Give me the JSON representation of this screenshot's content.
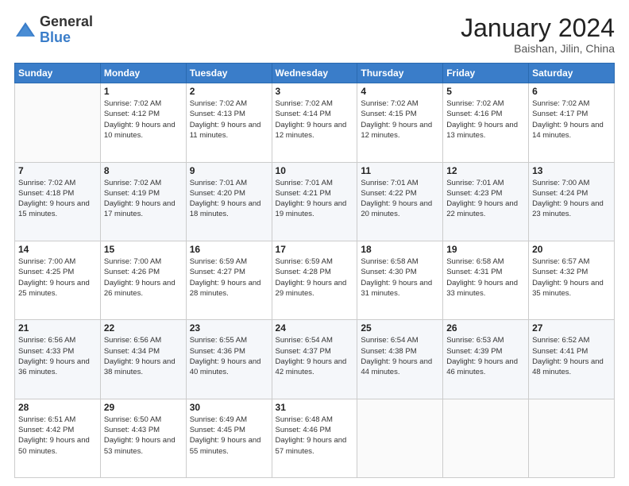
{
  "header": {
    "logo_general": "General",
    "logo_blue": "Blue",
    "month_title": "January 2024",
    "location": "Baishan, Jilin, China"
  },
  "weekdays": [
    "Sunday",
    "Monday",
    "Tuesday",
    "Wednesday",
    "Thursday",
    "Friday",
    "Saturday"
  ],
  "weeks": [
    [
      {
        "day": "",
        "sunrise": "",
        "sunset": "",
        "daylight": ""
      },
      {
        "day": "1",
        "sunrise": "Sunrise: 7:02 AM",
        "sunset": "Sunset: 4:12 PM",
        "daylight": "Daylight: 9 hours and 10 minutes."
      },
      {
        "day": "2",
        "sunrise": "Sunrise: 7:02 AM",
        "sunset": "Sunset: 4:13 PM",
        "daylight": "Daylight: 9 hours and 11 minutes."
      },
      {
        "day": "3",
        "sunrise": "Sunrise: 7:02 AM",
        "sunset": "Sunset: 4:14 PM",
        "daylight": "Daylight: 9 hours and 12 minutes."
      },
      {
        "day": "4",
        "sunrise": "Sunrise: 7:02 AM",
        "sunset": "Sunset: 4:15 PM",
        "daylight": "Daylight: 9 hours and 12 minutes."
      },
      {
        "day": "5",
        "sunrise": "Sunrise: 7:02 AM",
        "sunset": "Sunset: 4:16 PM",
        "daylight": "Daylight: 9 hours and 13 minutes."
      },
      {
        "day": "6",
        "sunrise": "Sunrise: 7:02 AM",
        "sunset": "Sunset: 4:17 PM",
        "daylight": "Daylight: 9 hours and 14 minutes."
      }
    ],
    [
      {
        "day": "7",
        "sunrise": "Sunrise: 7:02 AM",
        "sunset": "Sunset: 4:18 PM",
        "daylight": "Daylight: 9 hours and 15 minutes."
      },
      {
        "day": "8",
        "sunrise": "Sunrise: 7:02 AM",
        "sunset": "Sunset: 4:19 PM",
        "daylight": "Daylight: 9 hours and 17 minutes."
      },
      {
        "day": "9",
        "sunrise": "Sunrise: 7:01 AM",
        "sunset": "Sunset: 4:20 PM",
        "daylight": "Daylight: 9 hours and 18 minutes."
      },
      {
        "day": "10",
        "sunrise": "Sunrise: 7:01 AM",
        "sunset": "Sunset: 4:21 PM",
        "daylight": "Daylight: 9 hours and 19 minutes."
      },
      {
        "day": "11",
        "sunrise": "Sunrise: 7:01 AM",
        "sunset": "Sunset: 4:22 PM",
        "daylight": "Daylight: 9 hours and 20 minutes."
      },
      {
        "day": "12",
        "sunrise": "Sunrise: 7:01 AM",
        "sunset": "Sunset: 4:23 PM",
        "daylight": "Daylight: 9 hours and 22 minutes."
      },
      {
        "day": "13",
        "sunrise": "Sunrise: 7:00 AM",
        "sunset": "Sunset: 4:24 PM",
        "daylight": "Daylight: 9 hours and 23 minutes."
      }
    ],
    [
      {
        "day": "14",
        "sunrise": "Sunrise: 7:00 AM",
        "sunset": "Sunset: 4:25 PM",
        "daylight": "Daylight: 9 hours and 25 minutes."
      },
      {
        "day": "15",
        "sunrise": "Sunrise: 7:00 AM",
        "sunset": "Sunset: 4:26 PM",
        "daylight": "Daylight: 9 hours and 26 minutes."
      },
      {
        "day": "16",
        "sunrise": "Sunrise: 6:59 AM",
        "sunset": "Sunset: 4:27 PM",
        "daylight": "Daylight: 9 hours and 28 minutes."
      },
      {
        "day": "17",
        "sunrise": "Sunrise: 6:59 AM",
        "sunset": "Sunset: 4:28 PM",
        "daylight": "Daylight: 9 hours and 29 minutes."
      },
      {
        "day": "18",
        "sunrise": "Sunrise: 6:58 AM",
        "sunset": "Sunset: 4:30 PM",
        "daylight": "Daylight: 9 hours and 31 minutes."
      },
      {
        "day": "19",
        "sunrise": "Sunrise: 6:58 AM",
        "sunset": "Sunset: 4:31 PM",
        "daylight": "Daylight: 9 hours and 33 minutes."
      },
      {
        "day": "20",
        "sunrise": "Sunrise: 6:57 AM",
        "sunset": "Sunset: 4:32 PM",
        "daylight": "Daylight: 9 hours and 35 minutes."
      }
    ],
    [
      {
        "day": "21",
        "sunrise": "Sunrise: 6:56 AM",
        "sunset": "Sunset: 4:33 PM",
        "daylight": "Daylight: 9 hours and 36 minutes."
      },
      {
        "day": "22",
        "sunrise": "Sunrise: 6:56 AM",
        "sunset": "Sunset: 4:34 PM",
        "daylight": "Daylight: 9 hours and 38 minutes."
      },
      {
        "day": "23",
        "sunrise": "Sunrise: 6:55 AM",
        "sunset": "Sunset: 4:36 PM",
        "daylight": "Daylight: 9 hours and 40 minutes."
      },
      {
        "day": "24",
        "sunrise": "Sunrise: 6:54 AM",
        "sunset": "Sunset: 4:37 PM",
        "daylight": "Daylight: 9 hours and 42 minutes."
      },
      {
        "day": "25",
        "sunrise": "Sunrise: 6:54 AM",
        "sunset": "Sunset: 4:38 PM",
        "daylight": "Daylight: 9 hours and 44 minutes."
      },
      {
        "day": "26",
        "sunrise": "Sunrise: 6:53 AM",
        "sunset": "Sunset: 4:39 PM",
        "daylight": "Daylight: 9 hours and 46 minutes."
      },
      {
        "day": "27",
        "sunrise": "Sunrise: 6:52 AM",
        "sunset": "Sunset: 4:41 PM",
        "daylight": "Daylight: 9 hours and 48 minutes."
      }
    ],
    [
      {
        "day": "28",
        "sunrise": "Sunrise: 6:51 AM",
        "sunset": "Sunset: 4:42 PM",
        "daylight": "Daylight: 9 hours and 50 minutes."
      },
      {
        "day": "29",
        "sunrise": "Sunrise: 6:50 AM",
        "sunset": "Sunset: 4:43 PM",
        "daylight": "Daylight: 9 hours and 53 minutes."
      },
      {
        "day": "30",
        "sunrise": "Sunrise: 6:49 AM",
        "sunset": "Sunset: 4:45 PM",
        "daylight": "Daylight: 9 hours and 55 minutes."
      },
      {
        "day": "31",
        "sunrise": "Sunrise: 6:48 AM",
        "sunset": "Sunset: 4:46 PM",
        "daylight": "Daylight: 9 hours and 57 minutes."
      },
      {
        "day": "",
        "sunrise": "",
        "sunset": "",
        "daylight": ""
      },
      {
        "day": "",
        "sunrise": "",
        "sunset": "",
        "daylight": ""
      },
      {
        "day": "",
        "sunrise": "",
        "sunset": "",
        "daylight": ""
      }
    ]
  ]
}
